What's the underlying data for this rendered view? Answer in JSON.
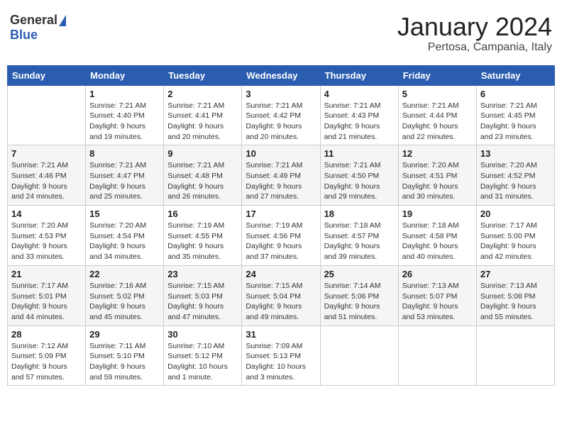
{
  "header": {
    "logo_general": "General",
    "logo_blue": "Blue",
    "main_title": "January 2024",
    "sub_title": "Pertosa, Campania, Italy"
  },
  "weekdays": [
    "Sunday",
    "Monday",
    "Tuesday",
    "Wednesday",
    "Thursday",
    "Friday",
    "Saturday"
  ],
  "weeks": [
    [
      {
        "day": "",
        "info": ""
      },
      {
        "day": "1",
        "info": "Sunrise: 7:21 AM\nSunset: 4:40 PM\nDaylight: 9 hours\nand 19 minutes."
      },
      {
        "day": "2",
        "info": "Sunrise: 7:21 AM\nSunset: 4:41 PM\nDaylight: 9 hours\nand 20 minutes."
      },
      {
        "day": "3",
        "info": "Sunrise: 7:21 AM\nSunset: 4:42 PM\nDaylight: 9 hours\nand 20 minutes."
      },
      {
        "day": "4",
        "info": "Sunrise: 7:21 AM\nSunset: 4:43 PM\nDaylight: 9 hours\nand 21 minutes."
      },
      {
        "day": "5",
        "info": "Sunrise: 7:21 AM\nSunset: 4:44 PM\nDaylight: 9 hours\nand 22 minutes."
      },
      {
        "day": "6",
        "info": "Sunrise: 7:21 AM\nSunset: 4:45 PM\nDaylight: 9 hours\nand 23 minutes."
      }
    ],
    [
      {
        "day": "7",
        "info": "Sunrise: 7:21 AM\nSunset: 4:46 PM\nDaylight: 9 hours\nand 24 minutes."
      },
      {
        "day": "8",
        "info": "Sunrise: 7:21 AM\nSunset: 4:47 PM\nDaylight: 9 hours\nand 25 minutes."
      },
      {
        "day": "9",
        "info": "Sunrise: 7:21 AM\nSunset: 4:48 PM\nDaylight: 9 hours\nand 26 minutes."
      },
      {
        "day": "10",
        "info": "Sunrise: 7:21 AM\nSunset: 4:49 PM\nDaylight: 9 hours\nand 27 minutes."
      },
      {
        "day": "11",
        "info": "Sunrise: 7:21 AM\nSunset: 4:50 PM\nDaylight: 9 hours\nand 29 minutes."
      },
      {
        "day": "12",
        "info": "Sunrise: 7:20 AM\nSunset: 4:51 PM\nDaylight: 9 hours\nand 30 minutes."
      },
      {
        "day": "13",
        "info": "Sunrise: 7:20 AM\nSunset: 4:52 PM\nDaylight: 9 hours\nand 31 minutes."
      }
    ],
    [
      {
        "day": "14",
        "info": "Sunrise: 7:20 AM\nSunset: 4:53 PM\nDaylight: 9 hours\nand 33 minutes."
      },
      {
        "day": "15",
        "info": "Sunrise: 7:20 AM\nSunset: 4:54 PM\nDaylight: 9 hours\nand 34 minutes."
      },
      {
        "day": "16",
        "info": "Sunrise: 7:19 AM\nSunset: 4:55 PM\nDaylight: 9 hours\nand 35 minutes."
      },
      {
        "day": "17",
        "info": "Sunrise: 7:19 AM\nSunset: 4:56 PM\nDaylight: 9 hours\nand 37 minutes."
      },
      {
        "day": "18",
        "info": "Sunrise: 7:18 AM\nSunset: 4:57 PM\nDaylight: 9 hours\nand 39 minutes."
      },
      {
        "day": "19",
        "info": "Sunrise: 7:18 AM\nSunset: 4:58 PM\nDaylight: 9 hours\nand 40 minutes."
      },
      {
        "day": "20",
        "info": "Sunrise: 7:17 AM\nSunset: 5:00 PM\nDaylight: 9 hours\nand 42 minutes."
      }
    ],
    [
      {
        "day": "21",
        "info": "Sunrise: 7:17 AM\nSunset: 5:01 PM\nDaylight: 9 hours\nand 44 minutes."
      },
      {
        "day": "22",
        "info": "Sunrise: 7:16 AM\nSunset: 5:02 PM\nDaylight: 9 hours\nand 45 minutes."
      },
      {
        "day": "23",
        "info": "Sunrise: 7:15 AM\nSunset: 5:03 PM\nDaylight: 9 hours\nand 47 minutes."
      },
      {
        "day": "24",
        "info": "Sunrise: 7:15 AM\nSunset: 5:04 PM\nDaylight: 9 hours\nand 49 minutes."
      },
      {
        "day": "25",
        "info": "Sunrise: 7:14 AM\nSunset: 5:06 PM\nDaylight: 9 hours\nand 51 minutes."
      },
      {
        "day": "26",
        "info": "Sunrise: 7:13 AM\nSunset: 5:07 PM\nDaylight: 9 hours\nand 53 minutes."
      },
      {
        "day": "27",
        "info": "Sunrise: 7:13 AM\nSunset: 5:08 PM\nDaylight: 9 hours\nand 55 minutes."
      }
    ],
    [
      {
        "day": "28",
        "info": "Sunrise: 7:12 AM\nSunset: 5:09 PM\nDaylight: 9 hours\nand 57 minutes."
      },
      {
        "day": "29",
        "info": "Sunrise: 7:11 AM\nSunset: 5:10 PM\nDaylight: 9 hours\nand 59 minutes."
      },
      {
        "day": "30",
        "info": "Sunrise: 7:10 AM\nSunset: 5:12 PM\nDaylight: 10 hours\nand 1 minute."
      },
      {
        "day": "31",
        "info": "Sunrise: 7:09 AM\nSunset: 5:13 PM\nDaylight: 10 hours\nand 3 minutes."
      },
      {
        "day": "",
        "info": ""
      },
      {
        "day": "",
        "info": ""
      },
      {
        "day": "",
        "info": ""
      }
    ]
  ]
}
